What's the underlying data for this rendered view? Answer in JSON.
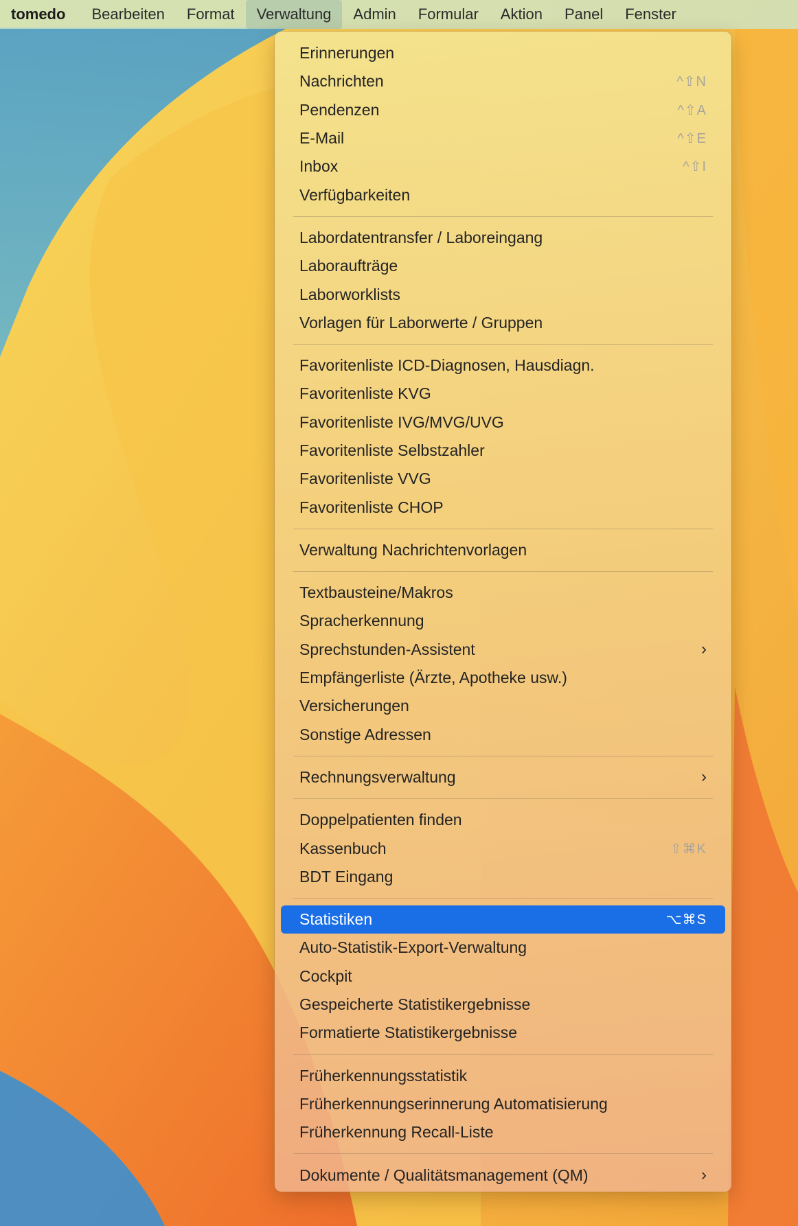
{
  "menubar": {
    "app_name": "tomedo",
    "items": [
      {
        "label": "Bearbeiten"
      },
      {
        "label": "Format"
      },
      {
        "label": "Verwaltung"
      },
      {
        "label": "Admin"
      },
      {
        "label": "Formular"
      },
      {
        "label": "Aktion"
      },
      {
        "label": "Panel"
      },
      {
        "label": "Fenster"
      }
    ],
    "active": "Verwaltung"
  },
  "menu": {
    "groups": [
      [
        {
          "label": "Erinnerungen",
          "shortcut": ""
        },
        {
          "label": "Nachrichten",
          "shortcut": "^⇧N"
        },
        {
          "label": "Pendenzen",
          "shortcut": "^⇧A"
        },
        {
          "label": "E-Mail",
          "shortcut": "^⇧E"
        },
        {
          "label": "Inbox",
          "shortcut": "^⇧I"
        },
        {
          "label": "Verfügbarkeiten",
          "shortcut": ""
        }
      ],
      [
        {
          "label": "Labordatentransfer / Laboreingang",
          "shortcut": ""
        },
        {
          "label": "Laboraufträge",
          "shortcut": ""
        },
        {
          "label": "Laborworklists",
          "shortcut": ""
        },
        {
          "label": "Vorlagen für Laborwerte / Gruppen",
          "shortcut": ""
        }
      ],
      [
        {
          "label": "Favoritenliste ICD-Diagnosen, Hausdiagn.",
          "shortcut": ""
        },
        {
          "label": "Favoritenliste KVG",
          "shortcut": ""
        },
        {
          "label": "Favoritenliste IVG/MVG/UVG",
          "shortcut": ""
        },
        {
          "label": "Favoritenliste Selbstzahler",
          "shortcut": ""
        },
        {
          "label": "Favoritenliste VVG",
          "shortcut": ""
        },
        {
          "label": "Favoritenliste CHOP",
          "shortcut": ""
        }
      ],
      [
        {
          "label": "Verwaltung Nachrichtenvorlagen",
          "shortcut": ""
        }
      ],
      [
        {
          "label": "Textbausteine/Makros",
          "shortcut": ""
        },
        {
          "label": "Spracherkennung",
          "shortcut": ""
        },
        {
          "label": "Sprechstunden-Assistent",
          "shortcut": "",
          "submenu": true
        },
        {
          "label": "Empfängerliste (Ärzte, Apotheke usw.)",
          "shortcut": ""
        },
        {
          "label": "Versicherungen",
          "shortcut": ""
        },
        {
          "label": "Sonstige Adressen",
          "shortcut": ""
        }
      ],
      [
        {
          "label": "Rechnungsverwaltung",
          "shortcut": "",
          "submenu": true
        }
      ],
      [
        {
          "label": "Doppelpatienten finden",
          "shortcut": ""
        },
        {
          "label": "Kassenbuch",
          "shortcut": "⇧⌘K"
        },
        {
          "label": "BDT Eingang",
          "shortcut": ""
        }
      ],
      [
        {
          "label": "Statistiken",
          "shortcut": "⌥⌘S",
          "selected": true
        },
        {
          "label": "Auto-Statistik-Export-Verwaltung",
          "shortcut": ""
        },
        {
          "label": "Cockpit",
          "shortcut": ""
        },
        {
          "label": "Gespeicherte Statistikergebnisse",
          "shortcut": ""
        },
        {
          "label": "Formatierte Statistikergebnisse",
          "shortcut": ""
        }
      ],
      [
        {
          "label": "Früherkennungsstatistik",
          "shortcut": ""
        },
        {
          "label": "Früherkennungserinnerung Automatisierung",
          "shortcut": ""
        },
        {
          "label": "Früherkennung Recall-Liste",
          "shortcut": ""
        }
      ],
      [
        {
          "label": "Dokumente / Qualitätsmanagement (QM)",
          "shortcut": "",
          "submenu": true
        }
      ]
    ],
    "submenu_icon": "chevron-right-icon",
    "selected_color": "#1a6fe6"
  }
}
